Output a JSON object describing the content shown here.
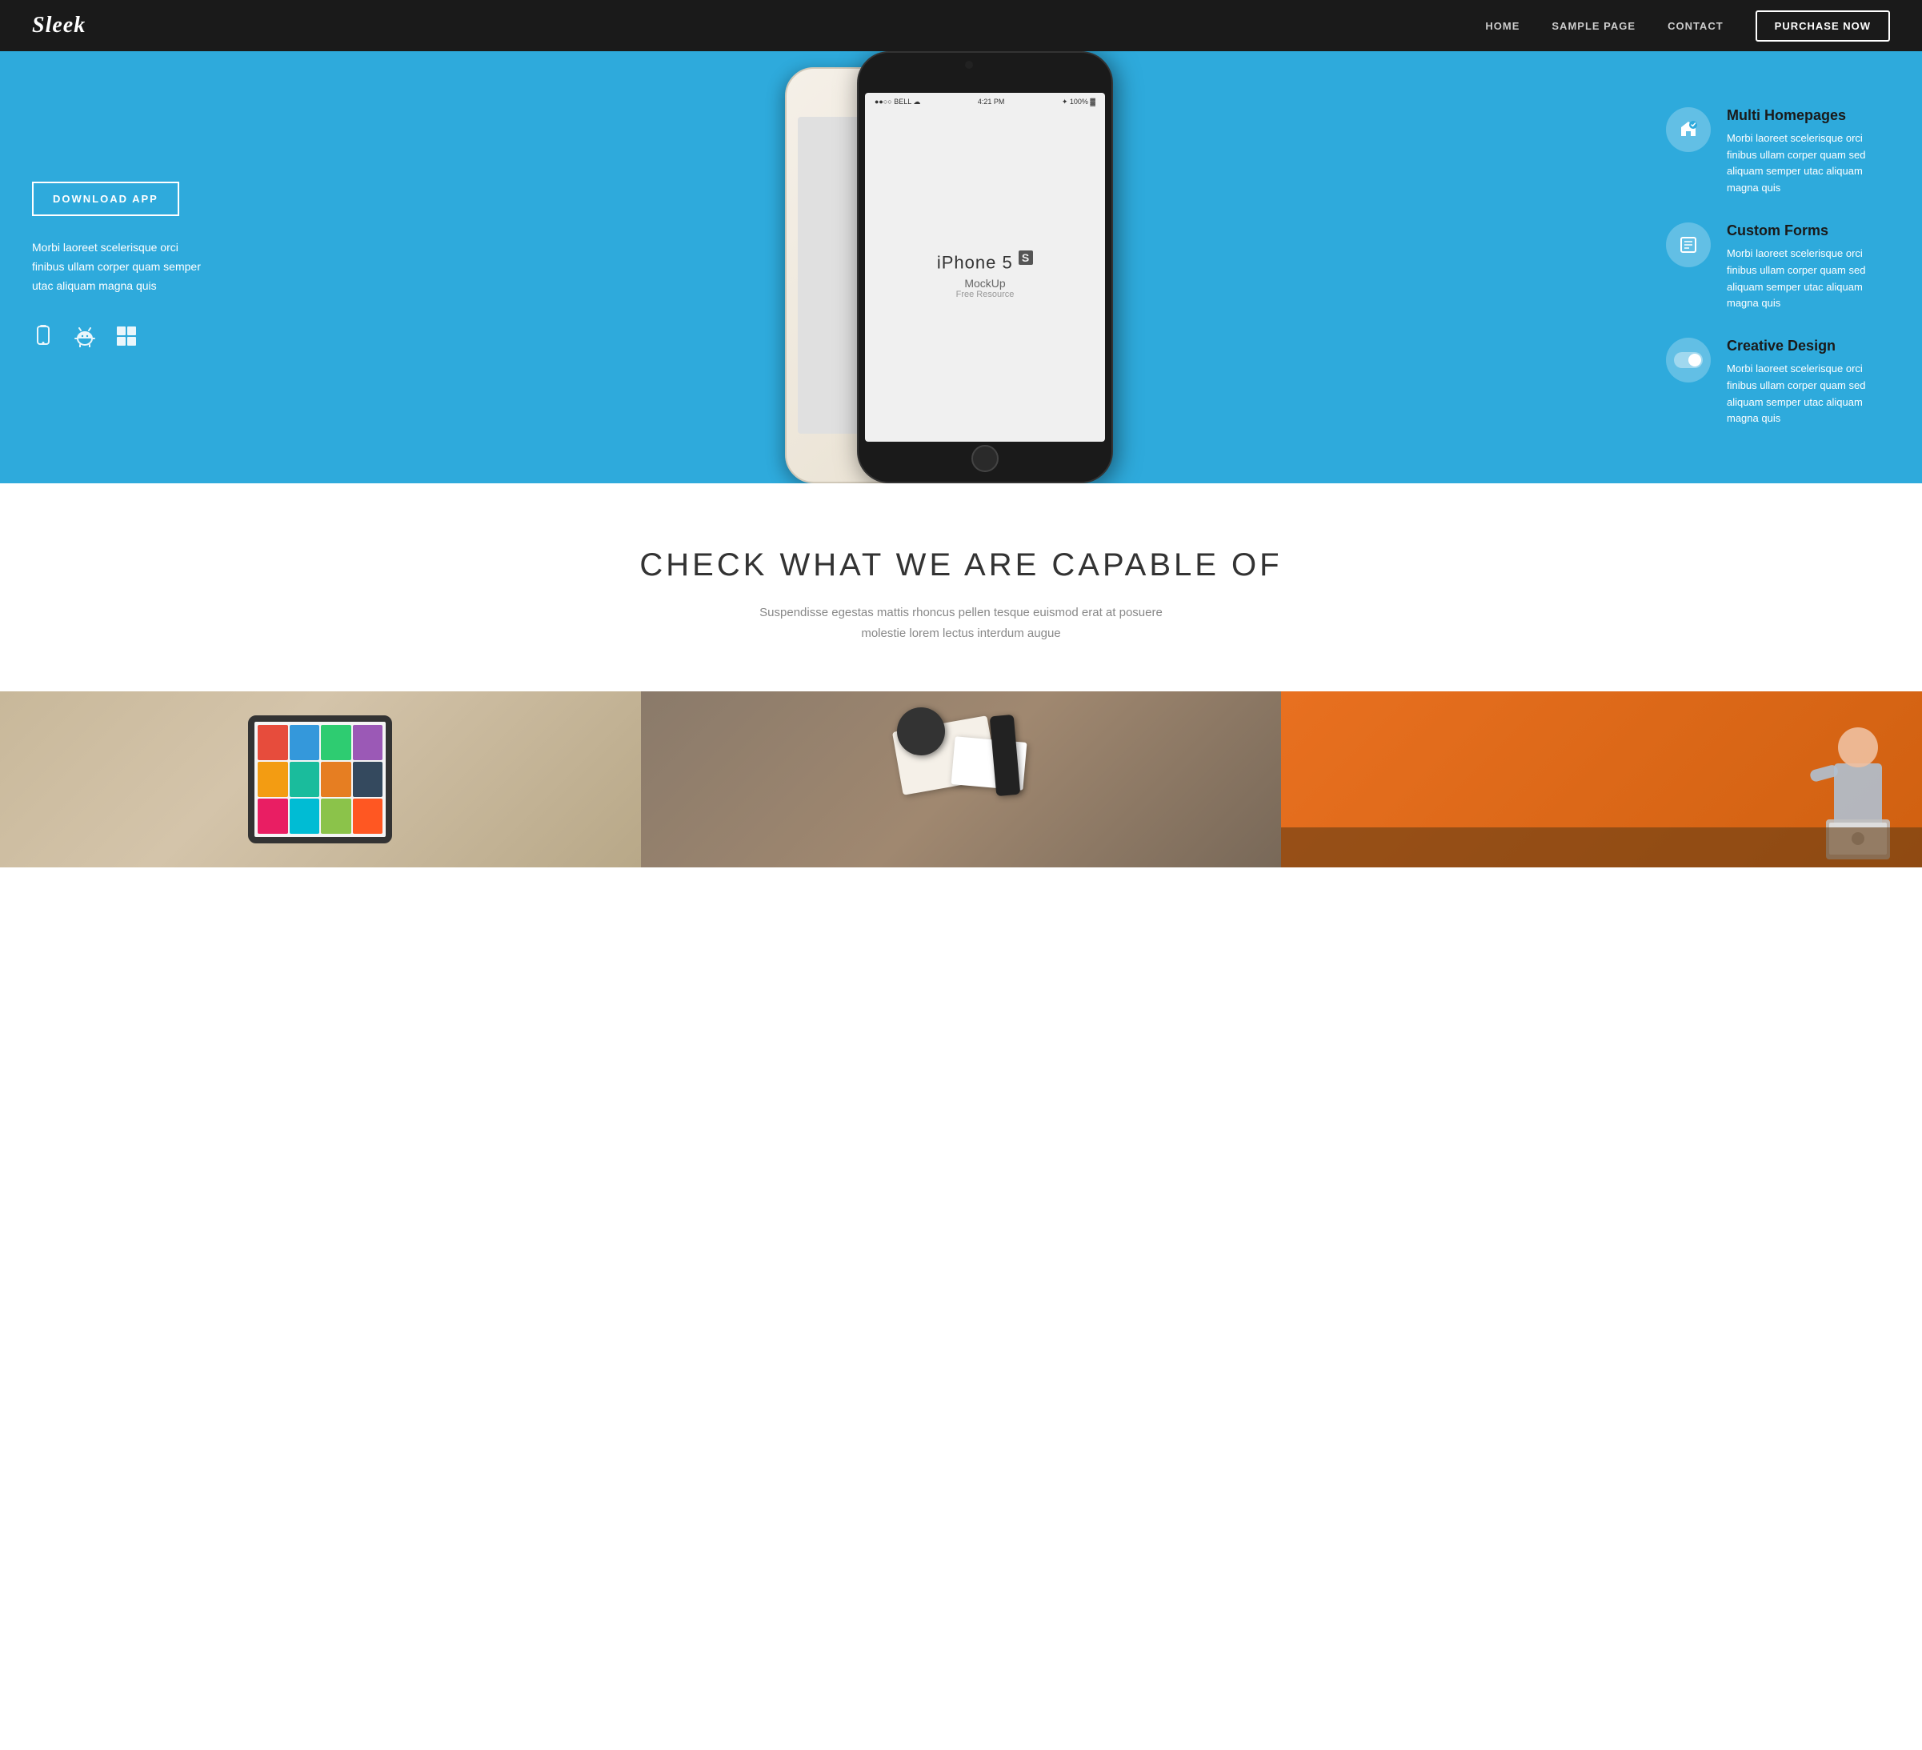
{
  "nav": {
    "logo": "Sleek",
    "links": [
      {
        "id": "home",
        "label": "HOME"
      },
      {
        "id": "sample-page",
        "label": "SAMPLE PAGE"
      },
      {
        "id": "contact",
        "label": "CONTACT"
      }
    ],
    "purchase_label": "PURCHASE NOW"
  },
  "hero": {
    "download_btn": "DOWNLOAD APP",
    "description": "Morbi laoreet scelerisque orci finibus ullam corper quam semper utac aliquam magna quis",
    "platforms": [
      {
        "id": "ios",
        "icon": "📱",
        "label": "iOS"
      },
      {
        "id": "android",
        "icon": "🤖",
        "label": "Android"
      },
      {
        "id": "windows",
        "icon": "⊞",
        "label": "Windows"
      }
    ],
    "phone_model": "iPhone 5",
    "phone_variant": "S",
    "phone_sub": "MockUp",
    "phone_sub2": "Free Resource",
    "phone_status_carrier": "●●○○ BELL  ☁",
    "phone_status_time": "4:21 PM",
    "phone_status_battery": "✦ 100%  ▓",
    "features": [
      {
        "id": "multi-homepages",
        "icon": "✦",
        "title": "Multi Homepages",
        "description": "Morbi laoreet scelerisque orci finibus ullam corper quam sed aliquam semper utac aliquam magna quis"
      },
      {
        "id": "custom-forms",
        "icon": "▭",
        "title": "Custom Forms",
        "description": "Morbi laoreet scelerisque orci finibus ullam corper quam sed aliquam semper utac aliquam magna quis"
      },
      {
        "id": "creative-design",
        "icon": "◉",
        "title": "Creative Design",
        "description": "Morbi laoreet scelerisque orci finibus ullam corper quam sed aliquam semper utac aliquam magna quis"
      }
    ]
  },
  "capabilities": {
    "heading": "CHECK WHAT WE ARE CAPABLE OF",
    "subtitle": "Suspendisse egestas mattis rhoncus pellen tesque euismod erat at posuere molestie lorem lectus interdum augue",
    "cards": [
      {
        "id": "tablet",
        "type": "tablet-photo",
        "alt": "Tablet with app gallery"
      },
      {
        "id": "stationery",
        "type": "stationery-photo",
        "alt": "Stationery and branding materials"
      },
      {
        "id": "person",
        "type": "person-photo",
        "alt": "Person working on laptop"
      }
    ]
  }
}
